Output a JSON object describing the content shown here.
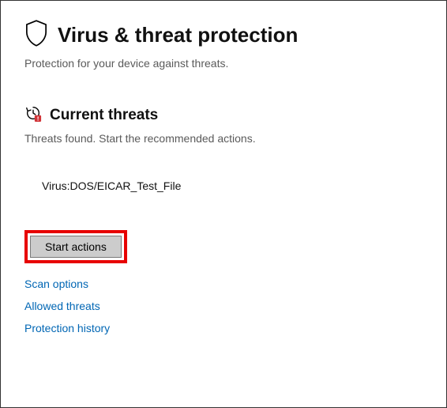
{
  "header": {
    "title": "Virus & threat protection",
    "subtitle": "Protection for your device against threats."
  },
  "current_threats": {
    "title": "Current threats",
    "description": "Threats found. Start the recommended actions.",
    "items": [
      {
        "name": "Virus:DOS/EICAR_Test_File"
      }
    ],
    "start_actions_label": "Start actions"
  },
  "links": {
    "scan_options": "Scan options",
    "allowed_threats": "Allowed threats",
    "protection_history": "Protection history"
  },
  "colors": {
    "link": "#0066b4",
    "highlight": "#e70000",
    "alert_badge": "#d13438"
  }
}
